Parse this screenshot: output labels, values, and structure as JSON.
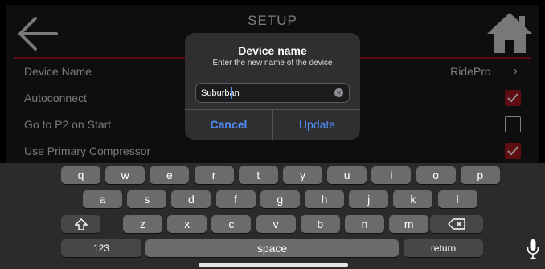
{
  "header": {
    "title": "SETUP",
    "back_icon": "arrow-left-icon",
    "home_icon": "home-icon"
  },
  "settings": {
    "device_name_label": "Device Name",
    "device_name_value": "RidePro",
    "autoconnect_label": "Autoconnect",
    "autoconnect_checked": true,
    "p2_label": "Go to P2 on Start",
    "p2_checked": false,
    "compressor_label": "Use Primary Compressor",
    "compressor_checked": true,
    "accent_color": "#a31822"
  },
  "dialog": {
    "title": "Device name",
    "message": "Enter the new name of the device",
    "input_value": "Suburban",
    "cancel": "Cancel",
    "update": "Update",
    "button_color": "#4f8ff7"
  },
  "keyboard": {
    "row1": [
      "q",
      "w",
      "e",
      "r",
      "t",
      "y",
      "u",
      "i",
      "o",
      "p"
    ],
    "row2": [
      "a",
      "s",
      "d",
      "f",
      "g",
      "h",
      "j",
      "k",
      "l"
    ],
    "row3": [
      "z",
      "x",
      "c",
      "v",
      "b",
      "n",
      "m"
    ],
    "numbers": "123",
    "space": "space",
    "return": "return"
  }
}
